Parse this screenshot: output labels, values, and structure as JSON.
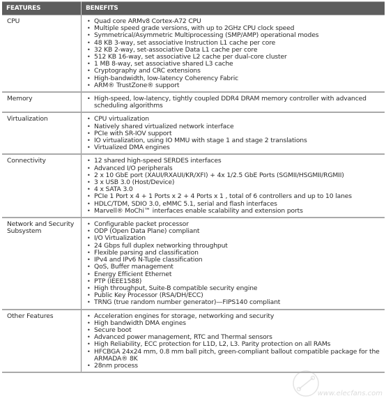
{
  "table": {
    "headers": [
      "FEATURES",
      "BENEFITS"
    ],
    "rows": [
      {
        "feature": "CPU",
        "benefits": [
          "Quad core ARMv8 Cortex-A72 CPU",
          "Multiple speed grade versions, with up to 2GHz CPU clock speed",
          "Symmetrical/Asymmetric Multiprocessing (SMP/AMP) operational modes",
          "48 KB 3-way, set associative Instruction L1 cache per core",
          "32 KB 2-way, set-associative Data L1 cache per core",
          "512 KB 16-way, set associative L2 cache per dual-core cluster",
          "1 MB 8-way, set associative shared L3 cache",
          "Cryptography and CRC extensions",
          "High-bandwidth, low-latency Coherency Fabric",
          "ARM® TrustZone® support"
        ]
      },
      {
        "feature": "Memory",
        "benefits": [
          "High-speed, low-latency, tightly coupled DDR4 DRAM memory controller with advanced scheduling algorithms"
        ]
      },
      {
        "feature": "Virtualization",
        "benefits": [
          "CPU virtualization",
          "Natively shared virtualized network interface",
          "PCIe with SR-IOV support",
          "IO virtualization, using IO MMU with stage 1 and stage 2 translations",
          "Virtualized DMA engines"
        ]
      },
      {
        "feature": "Connectivity",
        "benefits": [
          "12 shared high-speed SERDES interfaces",
          "Advanced I/O peripherals",
          "2 x 10 GbE port (XAUI/RXAUI/KR/XFI) + 4x 1/2.5 GbE Ports (SGMII/HSGMII/RGMII)",
          "3 x USB 3.0 (Host/Device)",
          "4 x SATA 3.0",
          "PCIe 1 Port x 4 + 1 Ports x 2 + 4 Ports x 1 , total of 6 controllers and up to 10 lanes",
          "HDLC/TDM, SDIO 3.0, eMMC 5.1, serial and flash interfaces",
          "Marvell® MoChi™ interfaces enable scalability and extension ports"
        ]
      },
      {
        "feature": "Network and Security Subsystem",
        "benefits": [
          "Configurable packet processor",
          "ODP (Open Data Plane) compliant",
          "I/O Virtualization",
          "24 Gbps full duplex networking throughput",
          "Flexible parsing and classification",
          "IPv4 and IPv6 N-Tuple classification",
          "QoS, Buffer management",
          "Energy Efficient Ethernet",
          "PTP (IEEE1588)",
          "High throughput, Suite-B compatible security engine",
          "Public Key Processor (RSA/DH/ECC)",
          "TRNG (true random number generator)—FIPS140 compliant"
        ]
      },
      {
        "feature": "Other Features",
        "benefits": [
          "Acceleration engines for storage, networking and security",
          "High bandwidth DMA engines",
          "Secure boot",
          "Advanced power management, RTC and Thermal sensors",
          "High Reliability, ECC protection for L1D, L2, L3. Parity protection on all RAMs",
          "HFCBGA 24x24 mm, 0.8 mm ball pitch, green-compliant ballout compatible package for the ARMADA® 8K",
          "28nm process"
        ]
      }
    ]
  },
  "watermark": {
    "text": "www.elecfans.com"
  },
  "colors": {
    "header_bg": "#5d5d5d",
    "header_text": "#ffffff",
    "row_divider": "#a9a9a9",
    "body_text": "#2a2a2a"
  }
}
